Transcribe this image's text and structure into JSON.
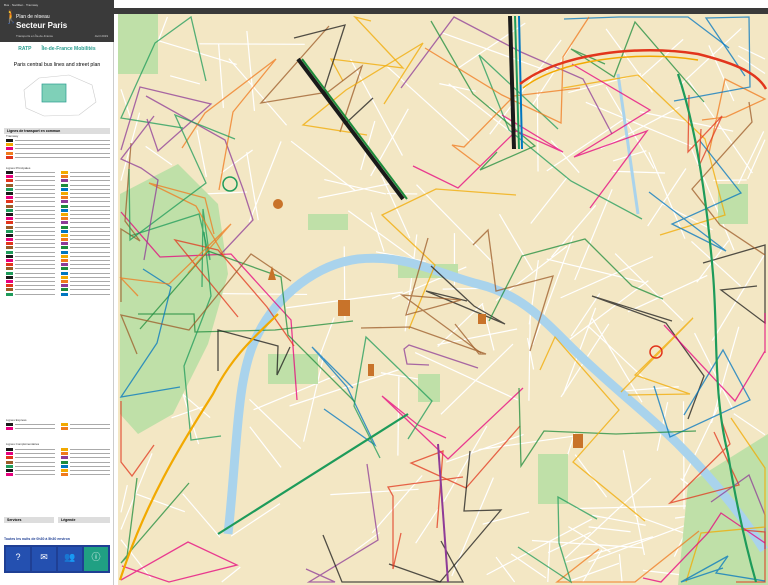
{
  "header": {
    "top_line": "Bus · Noctilien · Tramway",
    "plan": "Plan de réseau",
    "sector": "Secteur Paris",
    "subtitle": "Transports en Île-de-France",
    "date": "Avril 2019"
  },
  "logos": {
    "ratp": "RATP",
    "idfm": "Île-de-France Mobilités"
  },
  "map_title": "Paris central bus lines and street plan",
  "sections": {
    "transport": "Lignes de transport en commun",
    "tramway": "Tramway",
    "main": "Lignes Principales",
    "express": "Lignes Express",
    "complementary": "Lignes Complémentaires",
    "services": "Services",
    "legend": "Légende"
  },
  "footer": {
    "notice": "Toutes les nuits de 0h30 à 5h30 environ",
    "icons": [
      "info-icon",
      "mail-icon",
      "people-icon",
      "i-icon"
    ]
  },
  "colors": {
    "water": "#a9d3ec",
    "park": "#bfe0a8",
    "land": "#f3e7c4",
    "street": "#ffffff"
  },
  "lines": [
    {
      "color": "#1a1a1a"
    },
    {
      "color": "#1e8c3c"
    },
    {
      "color": "#e2351c"
    },
    {
      "color": "#f2a900"
    },
    {
      "color": "#1e9b5a"
    },
    {
      "color": "#8e3b97"
    },
    {
      "color": "#e6007e"
    },
    {
      "color": "#0076c0"
    },
    {
      "color": "#9c5b28"
    },
    {
      "color": "#f07a1d"
    }
  ]
}
